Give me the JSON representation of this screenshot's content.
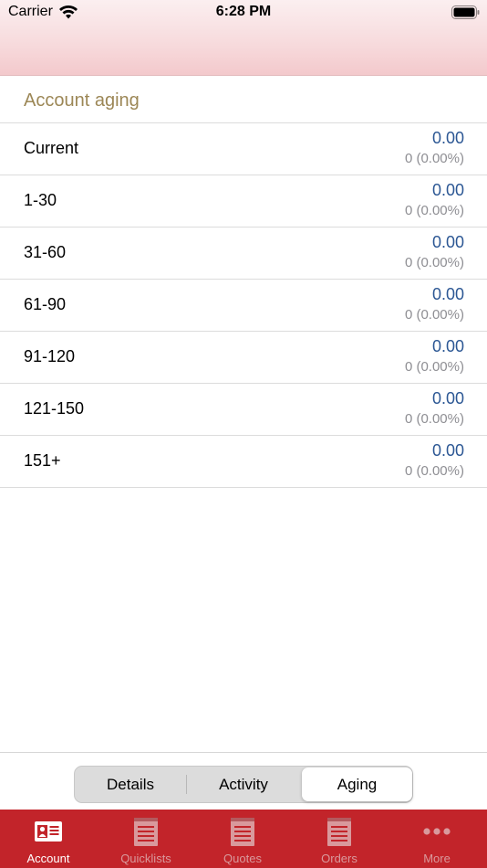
{
  "status_bar": {
    "carrier": "Carrier",
    "time": "6:28 PM"
  },
  "section": {
    "title": "Account aging"
  },
  "aging_rows": [
    {
      "label": "Current",
      "amount": "0.00",
      "count": "0 (0.00%)"
    },
    {
      "label": "1-30",
      "amount": "0.00",
      "count": "0 (0.00%)"
    },
    {
      "label": "31-60",
      "amount": "0.00",
      "count": "0 (0.00%)"
    },
    {
      "label": "61-90",
      "amount": "0.00",
      "count": "0 (0.00%)"
    },
    {
      "label": "91-120",
      "amount": "0.00",
      "count": "0 (0.00%)"
    },
    {
      "label": "121-150",
      "amount": "0.00",
      "count": "0 (0.00%)"
    },
    {
      "label": "151+",
      "amount": "0.00",
      "count": "0 (0.00%)"
    }
  ],
  "segments": {
    "details": "Details",
    "activity": "Activity",
    "aging": "Aging",
    "selected": "Aging"
  },
  "tabs": [
    {
      "label": "Account",
      "icon": "account-card-icon",
      "active": true
    },
    {
      "label": "Quicklists",
      "icon": "notepad-icon",
      "active": false
    },
    {
      "label": "Quotes",
      "icon": "notepad-icon",
      "active": false
    },
    {
      "label": "Orders",
      "icon": "notepad-icon",
      "active": false
    },
    {
      "label": "More",
      "icon": "more-dots-icon",
      "active": false
    }
  ],
  "colors": {
    "accent": "#c2242a",
    "section_title": "#9c8756",
    "amount": "#2c5794",
    "secondary_text": "#8e8e93"
  }
}
